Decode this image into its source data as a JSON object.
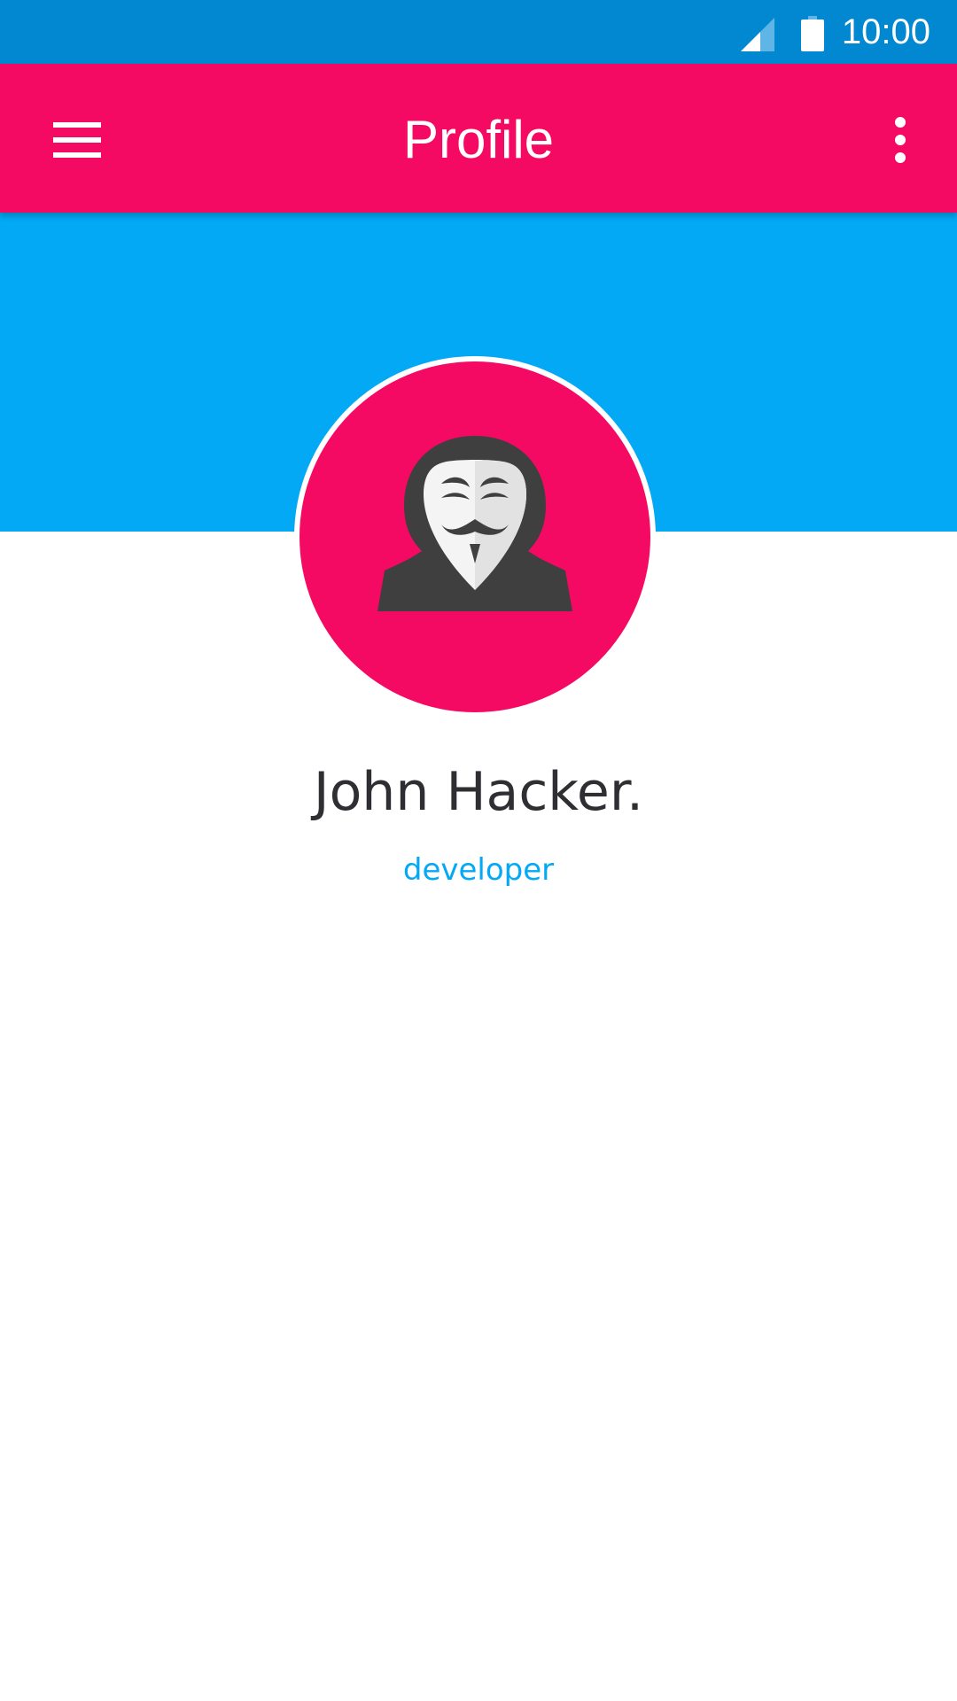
{
  "status_bar": {
    "time": "10:00",
    "signal_icon": "cell-signal-icon",
    "battery_icon": "battery-icon",
    "background_color": "#0288D1"
  },
  "app_bar": {
    "title": "Profile",
    "menu_icon": "hamburger-menu-icon",
    "overflow_icon": "more-vert-icon",
    "background_color": "#F50A63"
  },
  "cover": {
    "background_color": "#03A9F4"
  },
  "profile": {
    "avatar_icon": "anonymous-hacker-avatar-icon",
    "avatar_background_color": "#F50A63",
    "name": "John Hacker.",
    "role": "developer",
    "role_color": "#03A9F4"
  }
}
